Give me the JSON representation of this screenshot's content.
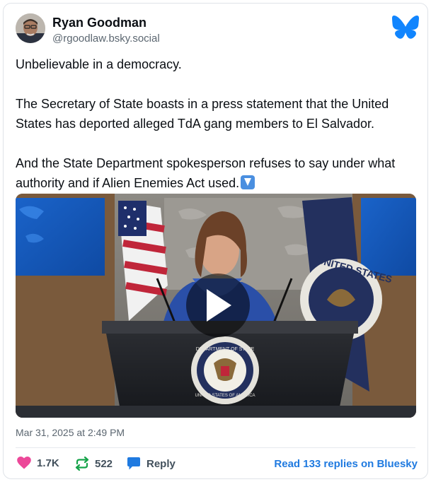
{
  "author": {
    "name": "Ryan Goodman",
    "handle": "@rgoodlaw.bsky.social"
  },
  "post": {
    "paragraphs": [
      "Unbelievable in a democracy.",
      "The Secretary of State boasts in a press statement that the United\nStates has deported alleged TdA gang members to El Salvador.",
      "And the State Department spokesperson refuses to say under what\nauthority and if Alien Enemies Act used."
    ],
    "emoji": "down-arrow-emoji",
    "timestamp": "Mar 31, 2025 at 2:49 PM"
  },
  "video": {
    "seal_text_top": "DEPARTMENT OF STATE",
    "seal_text_bottom": "UNITED STATES OF AMERICA",
    "flag_text": "UNITED STATES"
  },
  "actions": {
    "likes": "1.7K",
    "reposts": "522",
    "reply_label": "Reply",
    "read_replies": "Read 133 replies on Bluesky"
  },
  "colors": {
    "brand_blue": "#1185fe",
    "like_pink": "#ec4899",
    "repost_green": "#16a34a",
    "reply_blue": "#1f7ae0",
    "link_blue": "#1f7ae0"
  }
}
